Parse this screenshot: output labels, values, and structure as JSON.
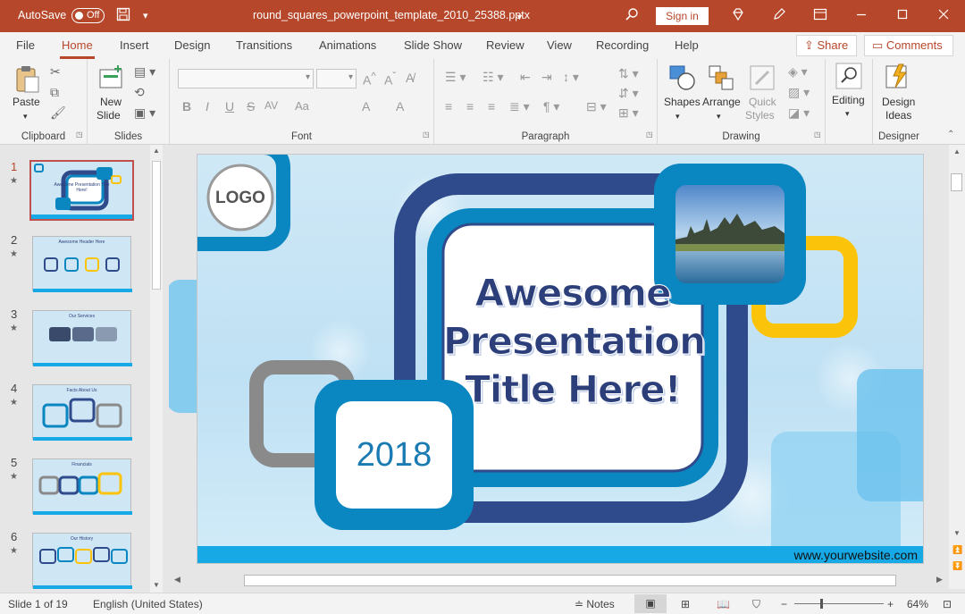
{
  "titlebar": {
    "autosave_label": "AutoSave",
    "autosave_state": "Off",
    "document_title": "round_squares_powerpoint_template_2010_25388.pptx",
    "sign_in": "Sign in",
    "icons": [
      "save-icon",
      "customize-qat-icon",
      "search-icon",
      "diamond-icon",
      "pen-icon",
      "ribbon-display-icon",
      "minimize-icon",
      "maximize-icon",
      "close-icon"
    ]
  },
  "tabs": [
    "File",
    "Home",
    "Insert",
    "Design",
    "Transitions",
    "Animations",
    "Slide Show",
    "Review",
    "View",
    "Recording",
    "Help"
  ],
  "active_tab": "Home",
  "share_label": "Share",
  "comments_label": "Comments",
  "ribbon": {
    "clipboard": {
      "label": "Clipboard",
      "paste": "Paste"
    },
    "slides": {
      "label": "Slides",
      "new_slide_1": "New",
      "new_slide_2": "Slide"
    },
    "font": {
      "label": "Font",
      "buttons": [
        "B",
        "I",
        "U",
        "S",
        "AV",
        "Aa",
        "A",
        "A"
      ]
    },
    "paragraph": {
      "label": "Paragraph"
    },
    "drawing": {
      "label": "Drawing",
      "shapes": "Shapes",
      "arrange": "Arrange",
      "quick_1": "Quick",
      "quick_2": "Styles"
    },
    "editing": {
      "label": "Editing"
    },
    "designer": {
      "label": "Designer",
      "ideas_1": "Design",
      "ideas_2": "Ideas"
    }
  },
  "thumbnails": [
    {
      "num": "1",
      "title": "Awesome Presentation Title Here!"
    },
    {
      "num": "2",
      "title": "Awesome Header Here"
    },
    {
      "num": "3",
      "title": "Our Services"
    },
    {
      "num": "4",
      "title": "Facts About Us"
    },
    {
      "num": "5",
      "title": "Financials"
    },
    {
      "num": "6",
      "title": "Our History"
    }
  ],
  "slide": {
    "logo": "LOGO",
    "title_1": "Awesome",
    "title_2": "Presentation",
    "title_3": "Title Here!",
    "year": "2018",
    "website": "www.yourwebsite.com"
  },
  "status": {
    "slide_info": "Slide 1 of 19",
    "language": "English (United States)",
    "notes": "Notes",
    "zoom": "64%"
  },
  "colors": {
    "accent": "#b7472a",
    "navy": "#2f4b8c",
    "teal": "#0a86c0",
    "yellow": "#fcc30b",
    "grey": "#8a8a8a",
    "title_text": "#2c3f7a",
    "website_bar": "#17a8e6"
  }
}
